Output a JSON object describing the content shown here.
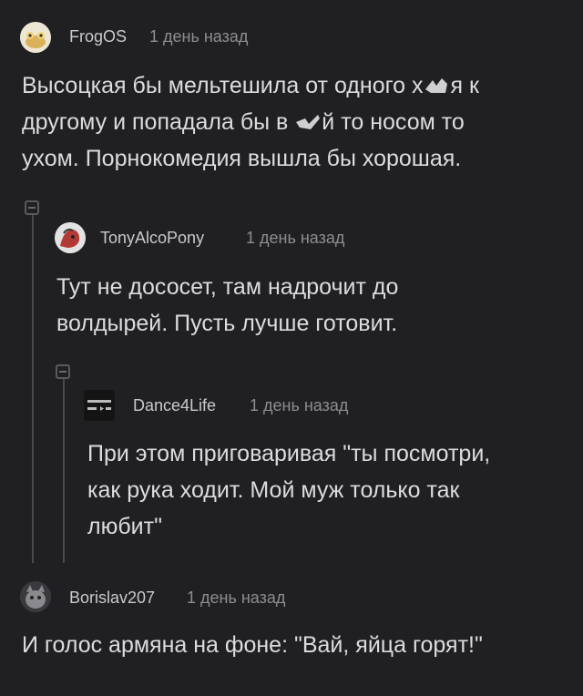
{
  "comments": [
    {
      "author": "FrogOS",
      "time": "1 день назад",
      "text_line1_a": "Высоцкая бы мельтешила от одного х",
      "text_line1_b": "я к",
      "text_line2_a": "другому и попадала бы в ",
      "text_line2_b": "й то носом то",
      "text_line3": "ухом. Порнокомедия вышла бы хорошая.",
      "avatar_icon": "frog-avatar-icon"
    },
    {
      "author": "TonyAlcoPony",
      "time": "1 день назад",
      "text_line1": "Тут не дососет, там надрочит до",
      "text_line2": "волдырей. Пусть лучше готовит.",
      "avatar_icon": "pony-avatar-icon"
    },
    {
      "author": "Dance4Life",
      "time": "1 день назад",
      "text_line1": "При этом приговаривая \"ты посмотри,",
      "text_line2": "как рука ходит. Мой муж только так",
      "text_line3": "любит\"",
      "avatar_icon": "depeche-mode-avatar-icon"
    },
    {
      "author": "Borislav207",
      "time": "1 день назад",
      "text_line1": "И голос армяна на фоне: \"Вай, яйца горят!\"",
      "avatar_icon": "cat-avatar-icon"
    }
  ],
  "colors": {
    "background": "#202023",
    "text": "#dcdcde",
    "muted": "#8d8d92",
    "thread_line": "#4a4a4e"
  }
}
